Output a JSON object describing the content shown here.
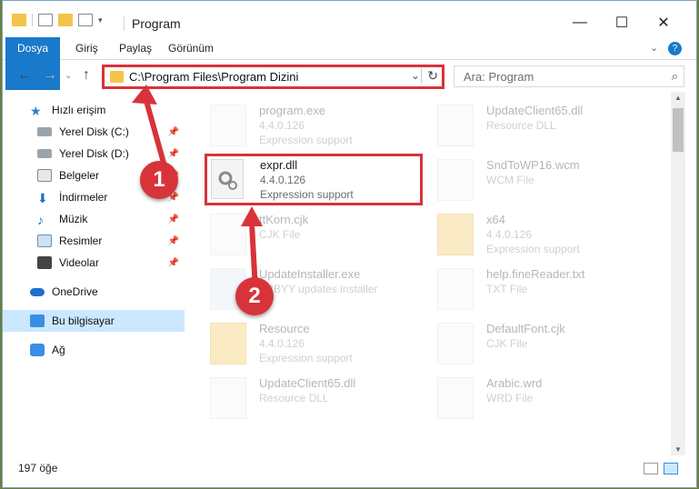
{
  "window": {
    "title": "Program"
  },
  "controls": {
    "minimize": "—",
    "maximize": "☐",
    "close": "✕"
  },
  "ribbon": {
    "tabs": [
      "Dosya",
      "Giriş",
      "Paylaş",
      "Görünüm"
    ],
    "help": "?"
  },
  "address": {
    "path": "C:\\Program Files\\Program Dizini"
  },
  "search": {
    "placeholder": "Ara: Program"
  },
  "sidebar": {
    "items": [
      {
        "label": "Hızlı erişim",
        "icon": "star-icon"
      },
      {
        "label": "Yerel Disk (C:)",
        "icon": "drive-icon"
      },
      {
        "label": "Yerel Disk (D:)",
        "icon": "drive-icon"
      },
      {
        "label": "Belgeler",
        "icon": "documents-icon"
      },
      {
        "label": "İndirmeler",
        "icon": "download-icon"
      },
      {
        "label": "Müzik",
        "icon": "music-icon"
      },
      {
        "label": "Resimler",
        "icon": "pictures-icon"
      },
      {
        "label": "Videolar",
        "icon": "videos-icon"
      },
      {
        "label": "OneDrive",
        "icon": "onedrive-icon"
      },
      {
        "label": "Bu bilgisayar",
        "icon": "computer-icon"
      },
      {
        "label": "Ağ",
        "icon": "network-icon"
      }
    ]
  },
  "files": {
    "left": [
      {
        "name": "program.exe",
        "meta1": "4.4.0.126",
        "meta2": "Expression support"
      },
      {
        "name": "expr.dll",
        "meta1": "4.4.0.126",
        "meta2": "Expression support"
      },
      {
        "name": "ttKorn.cjk",
        "meta1": "CJK File",
        "meta2": ""
      },
      {
        "name": "UpdateInstaller.exe",
        "meta1": "ABBYY updates installer",
        "meta2": ""
      },
      {
        "name": "Resource",
        "meta1": "4.4.0.126",
        "meta2": "Expression support"
      },
      {
        "name": "UpdateClient65.dll",
        "meta1": "Resource DLL",
        "meta2": ""
      }
    ],
    "right": [
      {
        "name": "UpdateClient65.dll",
        "meta1": "Resource DLL",
        "meta2": ""
      },
      {
        "name": "SndToWP16.wcm",
        "meta1": "WCM File",
        "meta2": ""
      },
      {
        "name": "x64",
        "meta1": "4.4.0.126",
        "meta2": "Expression support"
      },
      {
        "name": "help.fineReader.txt",
        "meta1": "TXT File",
        "meta2": ""
      },
      {
        "name": "DefaultFont.cjk",
        "meta1": "CJK File",
        "meta2": ""
      },
      {
        "name": "Arabic.wrd",
        "meta1": "WRD File",
        "meta2": ""
      }
    ]
  },
  "status": {
    "count": "197 öğe"
  },
  "steps": [
    "1",
    "2"
  ],
  "colors": {
    "accent": "#1979ca",
    "highlight": "#d8333a",
    "selected": "#cce8ff"
  }
}
